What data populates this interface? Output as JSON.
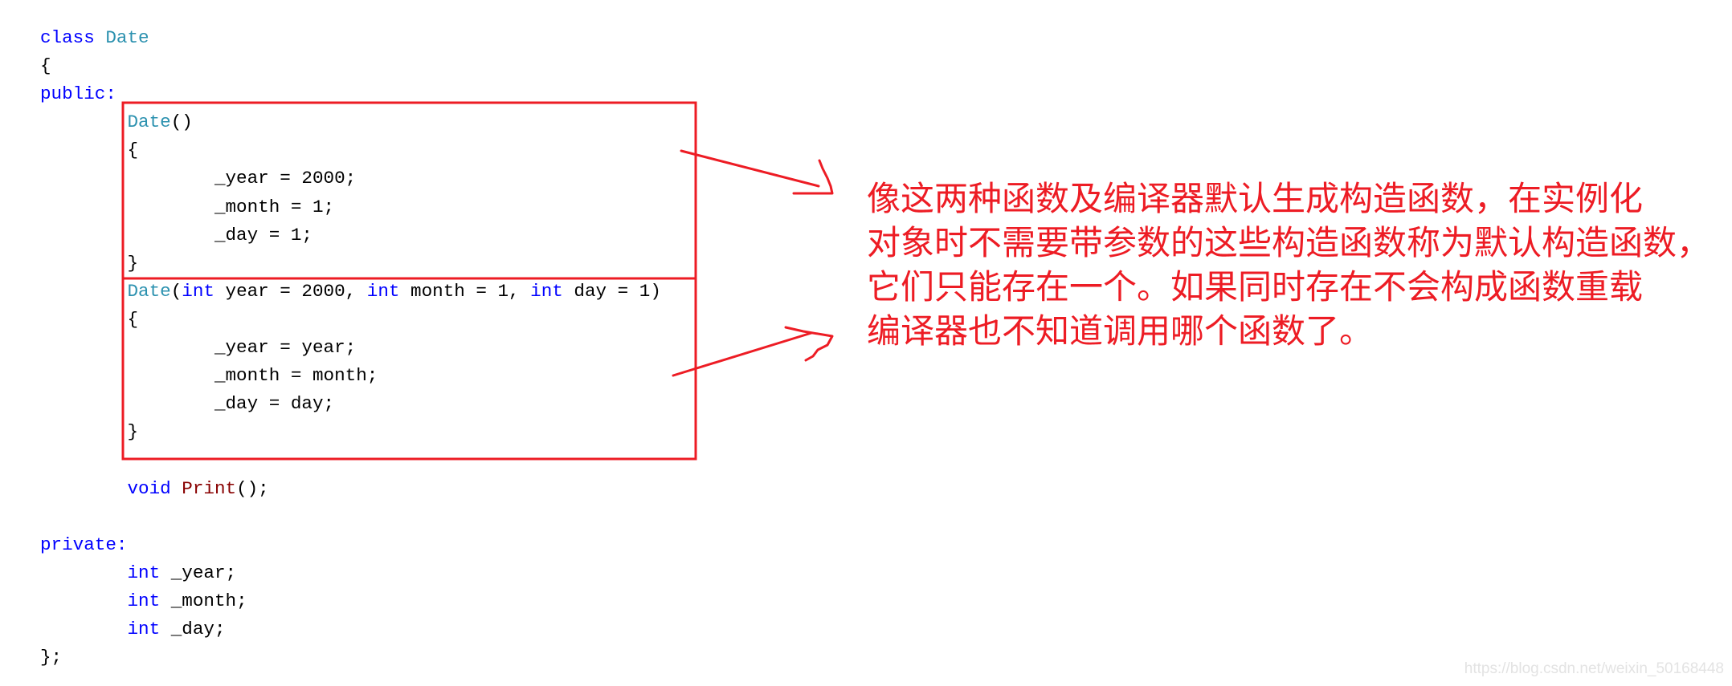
{
  "code": {
    "lines": [
      {
        "indent": "",
        "tokens": [
          {
            "t": "class",
            "k": "kw"
          },
          {
            "t": " ",
            "k": "plain"
          },
          {
            "t": "Date",
            "k": "ty"
          }
        ]
      },
      {
        "indent": "",
        "tokens": [
          {
            "t": "{",
            "k": "plain"
          }
        ]
      },
      {
        "indent": "",
        "tokens": [
          {
            "t": "public:",
            "k": "kw"
          }
        ]
      },
      {
        "indent": "\t",
        "tokens": [
          {
            "t": "Date",
            "k": "ty"
          },
          {
            "t": "()",
            "k": "plain"
          }
        ]
      },
      {
        "indent": "\t",
        "tokens": [
          {
            "t": "{",
            "k": "plain"
          }
        ]
      },
      {
        "indent": "\t\t",
        "tokens": [
          {
            "t": "_year = 2000;",
            "k": "plain"
          }
        ]
      },
      {
        "indent": "\t\t",
        "tokens": [
          {
            "t": "_month = 1;",
            "k": "plain"
          }
        ]
      },
      {
        "indent": "\t\t",
        "tokens": [
          {
            "t": "_day = 1;",
            "k": "plain"
          }
        ]
      },
      {
        "indent": "\t",
        "tokens": [
          {
            "t": "}",
            "k": "plain"
          }
        ]
      },
      {
        "indent": "\t",
        "tokens": [
          {
            "t": "Date",
            "k": "ty"
          },
          {
            "t": "(",
            "k": "plain"
          },
          {
            "t": "int",
            "k": "kw"
          },
          {
            "t": " year = 2000, ",
            "k": "plain"
          },
          {
            "t": "int",
            "k": "kw"
          },
          {
            "t": " month = 1, ",
            "k": "plain"
          },
          {
            "t": "int",
            "k": "kw"
          },
          {
            "t": " day = 1)",
            "k": "plain"
          }
        ]
      },
      {
        "indent": "\t",
        "tokens": [
          {
            "t": "{",
            "k": "plain"
          }
        ]
      },
      {
        "indent": "\t\t",
        "tokens": [
          {
            "t": "_year = year;",
            "k": "plain"
          }
        ]
      },
      {
        "indent": "\t\t",
        "tokens": [
          {
            "t": "_month = month;",
            "k": "plain"
          }
        ]
      },
      {
        "indent": "\t\t",
        "tokens": [
          {
            "t": "_day = day;",
            "k": "plain"
          }
        ]
      },
      {
        "indent": "\t",
        "tokens": [
          {
            "t": "}",
            "k": "plain"
          }
        ]
      },
      {
        "indent": "",
        "tokens": []
      },
      {
        "indent": "\t",
        "tokens": [
          {
            "t": "void",
            "k": "kw"
          },
          {
            "t": " ",
            "k": "plain"
          },
          {
            "t": "Print",
            "k": "fn"
          },
          {
            "t": "();",
            "k": "plain"
          }
        ]
      },
      {
        "indent": "",
        "tokens": []
      },
      {
        "indent": "",
        "tokens": [
          {
            "t": "private:",
            "k": "kw"
          }
        ]
      },
      {
        "indent": "\t",
        "tokens": [
          {
            "t": "int",
            "k": "kw"
          },
          {
            "t": " _year;",
            "k": "plain"
          }
        ]
      },
      {
        "indent": "\t",
        "tokens": [
          {
            "t": "int",
            "k": "kw"
          },
          {
            "t": " _month;",
            "k": "plain"
          }
        ]
      },
      {
        "indent": "\t",
        "tokens": [
          {
            "t": "int",
            "k": "kw"
          },
          {
            "t": " _day;",
            "k": "plain"
          }
        ]
      },
      {
        "indent": "",
        "tokens": [
          {
            "t": "};",
            "k": "plain"
          }
        ]
      }
    ]
  },
  "annotation": {
    "lines": [
      "像这两种函数及编译器默认生成构造函数，在实例化",
      "对象时不需要带参数的这些构造函数称为默认构造函数，",
      "它们只能存在一个。如果同时存在不会构成函数重载",
      "编译器也不知道调用哪个函数了。"
    ]
  },
  "colors": {
    "keyword": "#0000ff",
    "type_name": "#2b91af",
    "function_name": "#880000",
    "annotation_red": "#ed1c24"
  },
  "watermark": "https://blog.csdn.net/weixin_50168448"
}
